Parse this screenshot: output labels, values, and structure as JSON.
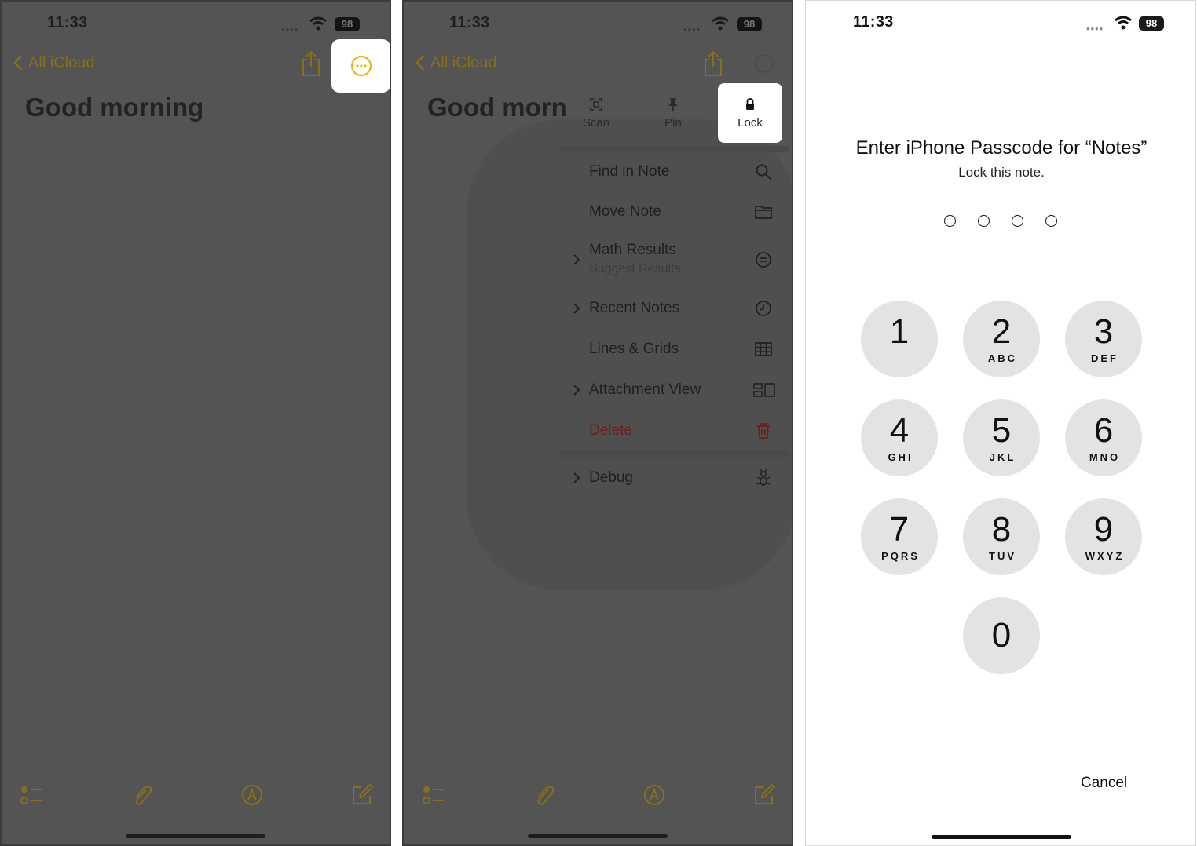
{
  "status": {
    "time": "11:33",
    "battery": "98"
  },
  "nav": {
    "back_label": "All iCloud"
  },
  "note": {
    "title": "Good morning",
    "title_truncated": "Good morn"
  },
  "menu": {
    "top_actions": [
      {
        "label": "Scan",
        "icon": "scan-icon"
      },
      {
        "label": "Pin",
        "icon": "pin-icon"
      },
      {
        "label": "Lock",
        "icon": "lock-icon"
      }
    ],
    "items": [
      {
        "label": "Find in Note",
        "icon": "magnifier-icon"
      },
      {
        "label": "Move Note",
        "icon": "folder-icon"
      },
      {
        "label": "Math Results",
        "sublabel": "Suggest Results",
        "icon": "equals-circle-icon"
      },
      {
        "label": "Recent Notes",
        "icon": "clock-icon"
      },
      {
        "label": "Lines & Grids",
        "icon": "grid-icon"
      },
      {
        "label": "Attachment View",
        "icon": "attachment-view-icon"
      },
      {
        "label": "Delete",
        "icon": "trash-icon"
      },
      {
        "label": "Debug",
        "icon": "ant-icon"
      }
    ]
  },
  "passcode": {
    "title": "Enter iPhone Passcode for “Notes”",
    "subtitle": "Lock this note.",
    "keys": [
      {
        "num": "1",
        "letters": ""
      },
      {
        "num": "2",
        "letters": "ABC"
      },
      {
        "num": "3",
        "letters": "DEF"
      },
      {
        "num": "4",
        "letters": "GHI"
      },
      {
        "num": "5",
        "letters": "JKL"
      },
      {
        "num": "6",
        "letters": "MNO"
      },
      {
        "num": "7",
        "letters": "PQRS"
      },
      {
        "num": "8",
        "letters": "TUV"
      },
      {
        "num": "9",
        "letters": "WXYZ"
      },
      {
        "num": "0",
        "letters": ""
      }
    ],
    "cancel_label": "Cancel"
  },
  "colors": {
    "accent": "#e6b91e",
    "dim_accent": "#8a6f18",
    "delete": "#6f1e1e",
    "keypad": "#e3e3e3"
  }
}
